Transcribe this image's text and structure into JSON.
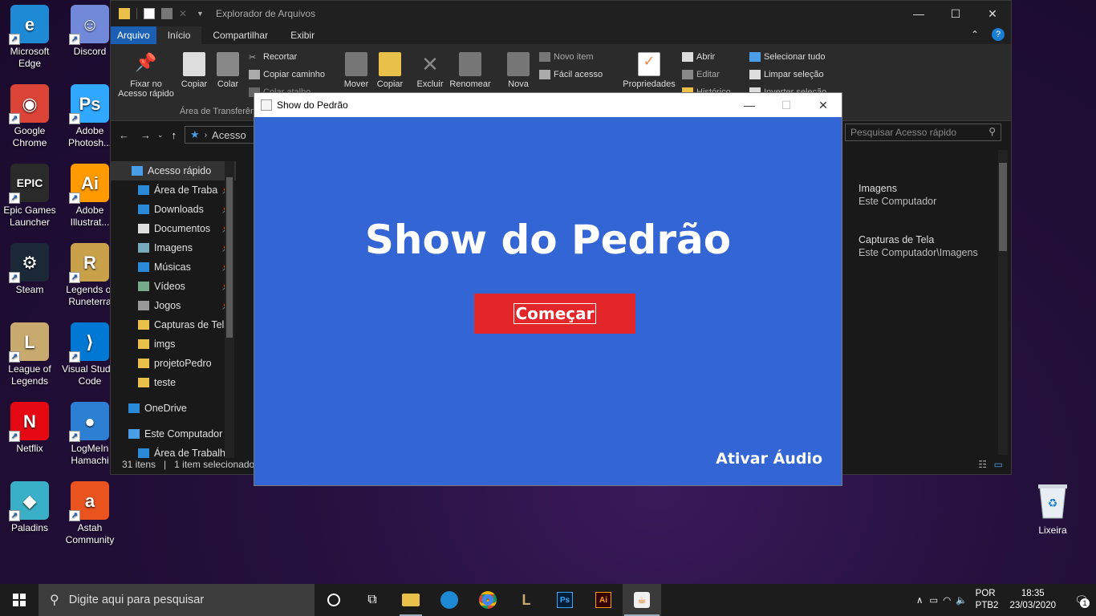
{
  "desktop": {
    "icons": [
      {
        "label": "Microsoft Edge",
        "icon": "edge-icon",
        "color": "#1e8ad6"
      },
      {
        "label": "Discord",
        "icon": "discord-icon",
        "color": "#7289da"
      },
      {
        "label": "Google Chrome",
        "icon": "chrome-icon",
        "color": "#db4437"
      },
      {
        "label": "Adobe Photosh...",
        "icon": "photoshop-icon",
        "color": "#31a8ff"
      },
      {
        "label": "Epic Games Launcher",
        "icon": "epic-games-icon",
        "color": "#2a2a2a"
      },
      {
        "label": "Adobe Illustrat...",
        "icon": "illustrator-icon",
        "color": "#ff9a00"
      },
      {
        "label": "Steam",
        "icon": "steam-icon",
        "color": "#1b2838"
      },
      {
        "label": "Legends of Runeterra",
        "icon": "runeterra-icon",
        "color": "#c9a14b"
      },
      {
        "label": "League of Legends",
        "icon": "league-icon",
        "color": "#c8aa6e"
      },
      {
        "label": "Visual Studio Code",
        "icon": "vscode-icon",
        "color": "#0078d4"
      },
      {
        "label": "Netflix",
        "icon": "netflix-icon",
        "color": "#e50914"
      },
      {
        "label": "LogMeIn Hamachi",
        "icon": "hamachi-icon",
        "color": "#2d7fd3"
      },
      {
        "label": "Paladins",
        "icon": "paladins-icon",
        "color": "#3ab0c8"
      },
      {
        "label": "Astah Community",
        "icon": "astah-icon",
        "color": "#e8531e"
      }
    ],
    "recycle_bin": "Lixeira"
  },
  "explorer": {
    "title": "Explorador de Arquivos",
    "tabs": [
      "Arquivo",
      "Início",
      "Compartilhar",
      "Exibir"
    ],
    "ribbon": {
      "pin": "Fixar no Acesso rápido",
      "copy": "Copiar",
      "paste": "Colar",
      "cut": "Recortar",
      "copy_path": "Copiar caminho",
      "paste_shortcut": "Colar atalho",
      "clipboard_group": "Área de Transferência",
      "move": "Mover",
      "copy_to": "Copiar",
      "delete": "Excluir",
      "rename": "Renomear",
      "new_folder": "Nova",
      "new_item": "Novo item",
      "easy_access": "Fácil acesso",
      "properties": "Propriedades",
      "open": "Abrir",
      "edit": "Editar",
      "history": "Histórico",
      "select_all": "Selecionar tudo",
      "clear_selection": "Limpar seleção",
      "invert_selection": "Inverter seleção"
    },
    "address": "Acesso",
    "search_placeholder": "Pesquisar Acesso rápido",
    "nav": [
      {
        "label": "Acesso rápido",
        "icon": "star-icon",
        "pinned": false
      },
      {
        "label": "Área de Traba",
        "icon": "desktop-folder-icon",
        "pinned": true
      },
      {
        "label": "Downloads",
        "icon": "download-icon",
        "pinned": true
      },
      {
        "label": "Documentos",
        "icon": "documents-icon",
        "pinned": true
      },
      {
        "label": "Imagens",
        "icon": "pictures-icon",
        "pinned": true
      },
      {
        "label": "Músicas",
        "icon": "music-icon",
        "pinned": true
      },
      {
        "label": "Vídeos",
        "icon": "videos-icon",
        "pinned": true
      },
      {
        "label": "Jogos",
        "icon": "drive-icon",
        "pinned": true
      },
      {
        "label": "Capturas de Tela",
        "icon": "folder-icon",
        "pinned": false
      },
      {
        "label": "imgs",
        "icon": "folder-icon",
        "pinned": false
      },
      {
        "label": "projetoPedro",
        "icon": "folder-icon",
        "pinned": false
      },
      {
        "label": "teste",
        "icon": "folder-icon",
        "pinned": false
      },
      {
        "label": "OneDrive",
        "icon": "cloud-icon",
        "pinned": false
      },
      {
        "label": "Este Computador",
        "icon": "computer-icon",
        "pinned": false
      },
      {
        "label": "Área de Trabalho",
        "icon": "desktop-folder-icon",
        "pinned": false
      }
    ],
    "content": [
      {
        "title": "Imagens",
        "sub": "Este Computador"
      },
      {
        "title": "Capturas de Tela",
        "sub": "Este Computador\\Imagens"
      }
    ],
    "status": {
      "count": "31 itens",
      "selected": "1 item selecionado"
    }
  },
  "java_window": {
    "title": "Show do Pedrão",
    "heading": "Show do Pedrão",
    "start_button": "Começar",
    "audio_label": "Ativar Áudio",
    "bg_color": "#3465d4",
    "button_color": "#e3262a"
  },
  "taskbar": {
    "search_placeholder": "Digite aqui para pesquisar",
    "lang_top": "POR",
    "lang_bottom": "PTB2",
    "time": "18:35",
    "date": "23/03/2020",
    "notifications": "1"
  }
}
